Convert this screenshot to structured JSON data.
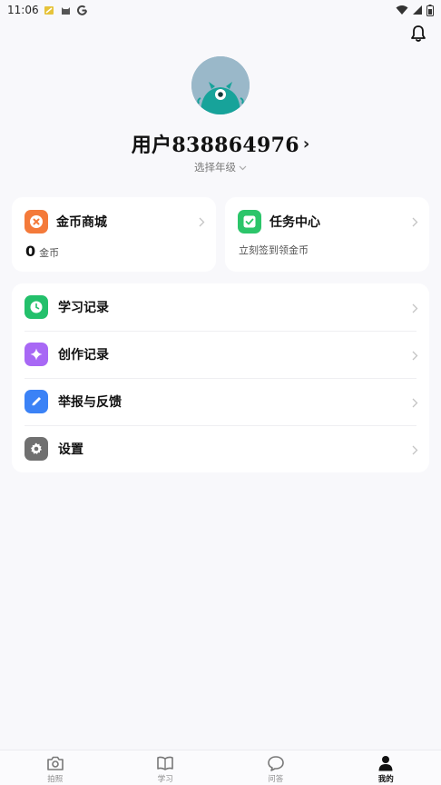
{
  "status_bar": {
    "time": "11:06",
    "left_icons": [
      "notification-icon",
      "cat-icon",
      "google-icon"
    ],
    "right_icons": [
      "wifi-icon",
      "signal-icon",
      "battery-icon"
    ]
  },
  "header": {
    "bell_icon": "bell-icon"
  },
  "profile": {
    "username": "用户838864976",
    "username_chevron": "›",
    "grade_label": "选择年级"
  },
  "cards": {
    "coins": {
      "title": "金币商城",
      "count": "0",
      "unit": "金币",
      "icon_color": "#f47a3a"
    },
    "tasks": {
      "title": "任务中心",
      "subtitle": "立刻签到领金币",
      "icon_color": "#2cc56a"
    }
  },
  "menu": {
    "items": [
      {
        "label": "学习记录",
        "icon": "clock-icon",
        "color": "#23c06b"
      },
      {
        "label": "创作记录",
        "icon": "sparkle-icon",
        "color": "#a868f5"
      },
      {
        "label": "举报与反馈",
        "icon": "pen-icon",
        "color": "#3b82f6"
      },
      {
        "label": "设置",
        "icon": "gear-icon",
        "color": "#707070"
      }
    ]
  },
  "tabs": [
    {
      "label": "拍照",
      "icon": "camera-icon",
      "active": false
    },
    {
      "label": "学习",
      "icon": "book-icon",
      "active": false
    },
    {
      "label": "问答",
      "icon": "chat-icon",
      "active": false
    },
    {
      "label": "我的",
      "icon": "person-icon",
      "active": true
    }
  ]
}
